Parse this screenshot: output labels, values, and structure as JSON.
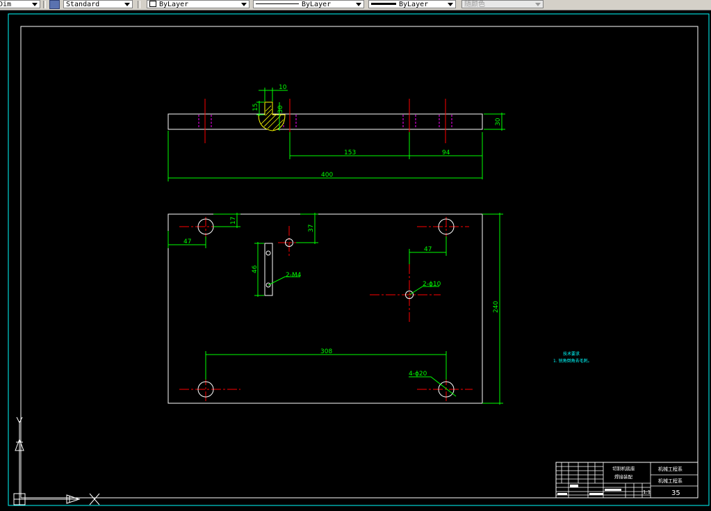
{
  "toolbar": {
    "dim_style": "Dim",
    "text_style": "Standard",
    "layer": "ByLayer",
    "linetype": "ByLayer",
    "lineweight": "ByLayer",
    "plot_style": "随颜色"
  },
  "colors": {
    "dimension": "#00ff00",
    "center": "#ff0000",
    "hidden": "#ff00ff",
    "frame": "#00ffff",
    "object": "#ffffff",
    "background": "#000000"
  },
  "drawing": {
    "top_view": {
      "dim_10": "10",
      "dim_15": "15",
      "dim_30_slot": "30",
      "dim_30_thk": "30",
      "dim_153": "153",
      "dim_94": "94",
      "dim_400": "400"
    },
    "plan_view": {
      "dim_17": "17",
      "dim_47_left": "47",
      "dim_37": "37",
      "dim_46": "46",
      "callout_m4": "2-M4",
      "dim_47_right": "47",
      "callout_phi10": "2-ϕ10",
      "dim_240": "240",
      "dim_308": "308",
      "callout_phi20": "4-ϕ20"
    },
    "notes": {
      "title": "技术要求",
      "line1": "1. 锐角倒角去毛刺。"
    },
    "title_block": {
      "name": "切割机底座",
      "subtitle": "焊接装配",
      "school": "机械工程系",
      "dept": "机械工程系",
      "scale": "1:1",
      "sheet": "35"
    }
  }
}
